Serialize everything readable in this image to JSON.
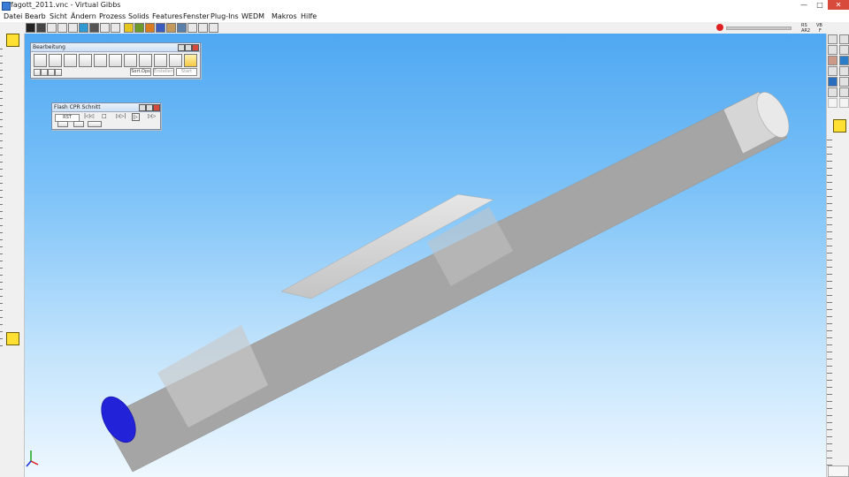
{
  "window": {
    "title": "fagott_2011.vnc - Virtual Gibbs",
    "controls": {
      "minimize": "—",
      "maximize": "□",
      "close": "✕"
    }
  },
  "menu": {
    "items": [
      "Datei",
      "Bearb",
      "Sicht",
      "Ändern",
      "Prozess",
      "Solids",
      "Features",
      "Fenster",
      "Plug-Ins",
      "WEDM",
      "Makros",
      "Hilfe"
    ]
  },
  "toolbar": {
    "coords": {
      "r1a": "RS",
      "r1b": "VB",
      "r2a": "AR2",
      "r2b": "F"
    }
  },
  "palette_bearbeitung": {
    "title": "Bearbeitung",
    "buttons": [
      "Sort.Ops",
      "Erstellen",
      "Start"
    ],
    "icons": [
      "drill-pattern-icon",
      "contour-icon",
      "face-icon",
      "pocket-icon",
      "lathe-icon",
      "thread-icon",
      "rough-icon",
      "slot-icon",
      "engrave-icon",
      "surface-icon",
      "tool-icon",
      "verify-icon"
    ]
  },
  "palette_flash": {
    "title": "Flash CPR Schnitt",
    "controls": [
      "RST",
      "|◁◁",
      "□",
      "▷▷|",
      "▷",
      "▷▷"
    ]
  },
  "colors": {
    "background_top": "#4fa8f2",
    "background_bottom": "#eef8ff",
    "part_face": "#2222d8",
    "part_body": "#d0d0d0"
  }
}
